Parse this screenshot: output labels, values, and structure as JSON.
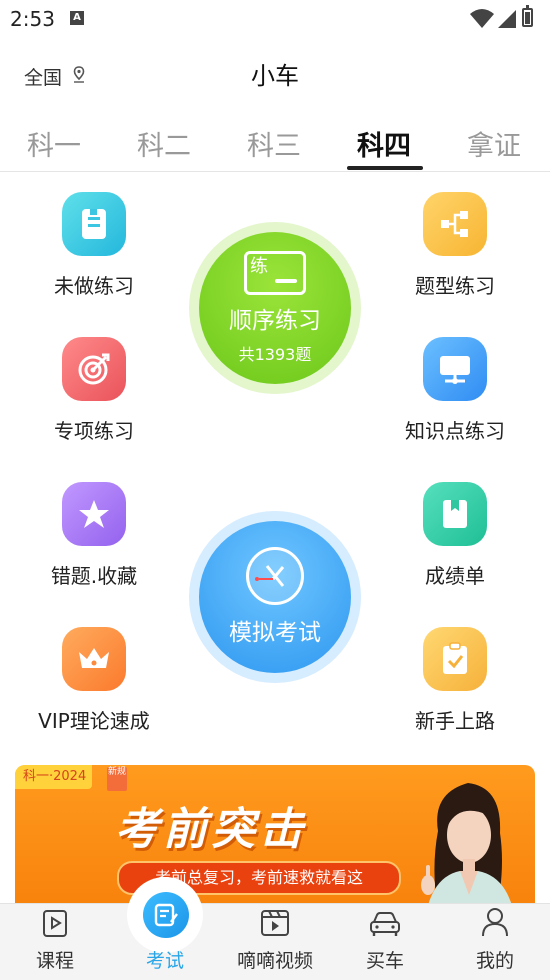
{
  "status_bar": {
    "time": "2:53",
    "notification_icon": "A"
  },
  "header": {
    "region": "全国",
    "title": "小车"
  },
  "tabs": [
    {
      "label": "科一"
    },
    {
      "label": "科二"
    },
    {
      "label": "科三"
    },
    {
      "label": "科四",
      "active": true
    },
    {
      "label": "拿证"
    }
  ],
  "practice": {
    "left": [
      {
        "label": "未做练习",
        "icon": "doc-icon"
      },
      {
        "label": "专项练习",
        "icon": "target-icon"
      },
      {
        "label": "错题.收藏",
        "icon": "star-icon"
      },
      {
        "label": "VIP理论速成",
        "icon": "crown-icon"
      }
    ],
    "right": [
      {
        "label": "题型练习",
        "icon": "share-nodes-icon"
      },
      {
        "label": "知识点练习",
        "icon": "monitor-icon"
      },
      {
        "label": "成绩单",
        "icon": "report-icon"
      },
      {
        "label": "新手上路",
        "icon": "checklist-icon"
      }
    ],
    "sequential": {
      "badge": "练",
      "title": "顺序练习",
      "sub": "共1393题"
    },
    "mock_exam": {
      "title": "模拟考试"
    }
  },
  "banner": {
    "tag": "科一·2024",
    "tag_new": "新规",
    "title": "考前突击",
    "subtitle": "考前总复习，考前速救就看这"
  },
  "bottom_nav": [
    {
      "label": "课程",
      "icon": "play-book-icon"
    },
    {
      "label": "考试",
      "icon": "exam-icon",
      "active": true
    },
    {
      "label": "嘀嘀视频",
      "icon": "video-icon"
    },
    {
      "label": "买车",
      "icon": "car-icon"
    },
    {
      "label": "我的",
      "icon": "user-icon"
    }
  ],
  "colors": {
    "accent": "#2aa6e8",
    "sequential_green": "#7ed321",
    "mock_blue": "#3ba5f5",
    "banner_orange": "#f88a12"
  }
}
